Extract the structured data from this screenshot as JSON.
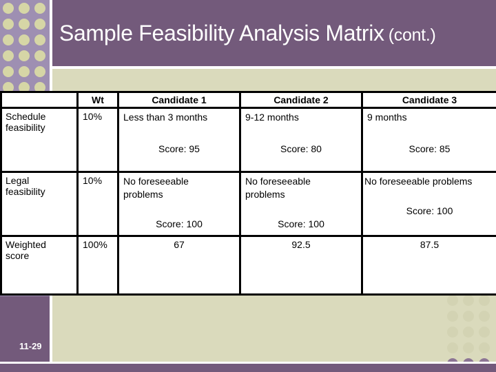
{
  "slide": {
    "title": "Sample Feasibility Analysis Matrix",
    "title_suffix": "(cont.)",
    "slide_number": "11-29",
    "colors": {
      "title_bar": "#735a7b",
      "left_strip": "#9e8fb2",
      "background": "#dadabc",
      "dots": "#d6d6a6",
      "table_border": "#000000"
    }
  },
  "matrix": {
    "headers": [
      "",
      "Wt",
      "Candidate 1",
      "Candidate 2",
      "Candidate 3"
    ],
    "rows": [
      {
        "label": "Schedule feasibility",
        "weight": "10%",
        "cells": [
          {
            "text": "Less than 3 months",
            "score": "Score: 95"
          },
          {
            "text": "9-12 months",
            "score": "Score: 80"
          },
          {
            "text": "9 months",
            "score": "Score: 85"
          }
        ]
      },
      {
        "label": "Legal feasibility",
        "weight": "10%",
        "cells": [
          {
            "text": "No foreseeable problems",
            "score": "Score: 100"
          },
          {
            "text": "No foreseeable problems",
            "score": "Score: 100"
          },
          {
            "text": "No foreseeable problems",
            "score": "Score: 100"
          }
        ]
      },
      {
        "label": "Weighted score",
        "weight": "100%",
        "totals": [
          "67",
          "92.5",
          "87.5"
        ]
      }
    ]
  }
}
